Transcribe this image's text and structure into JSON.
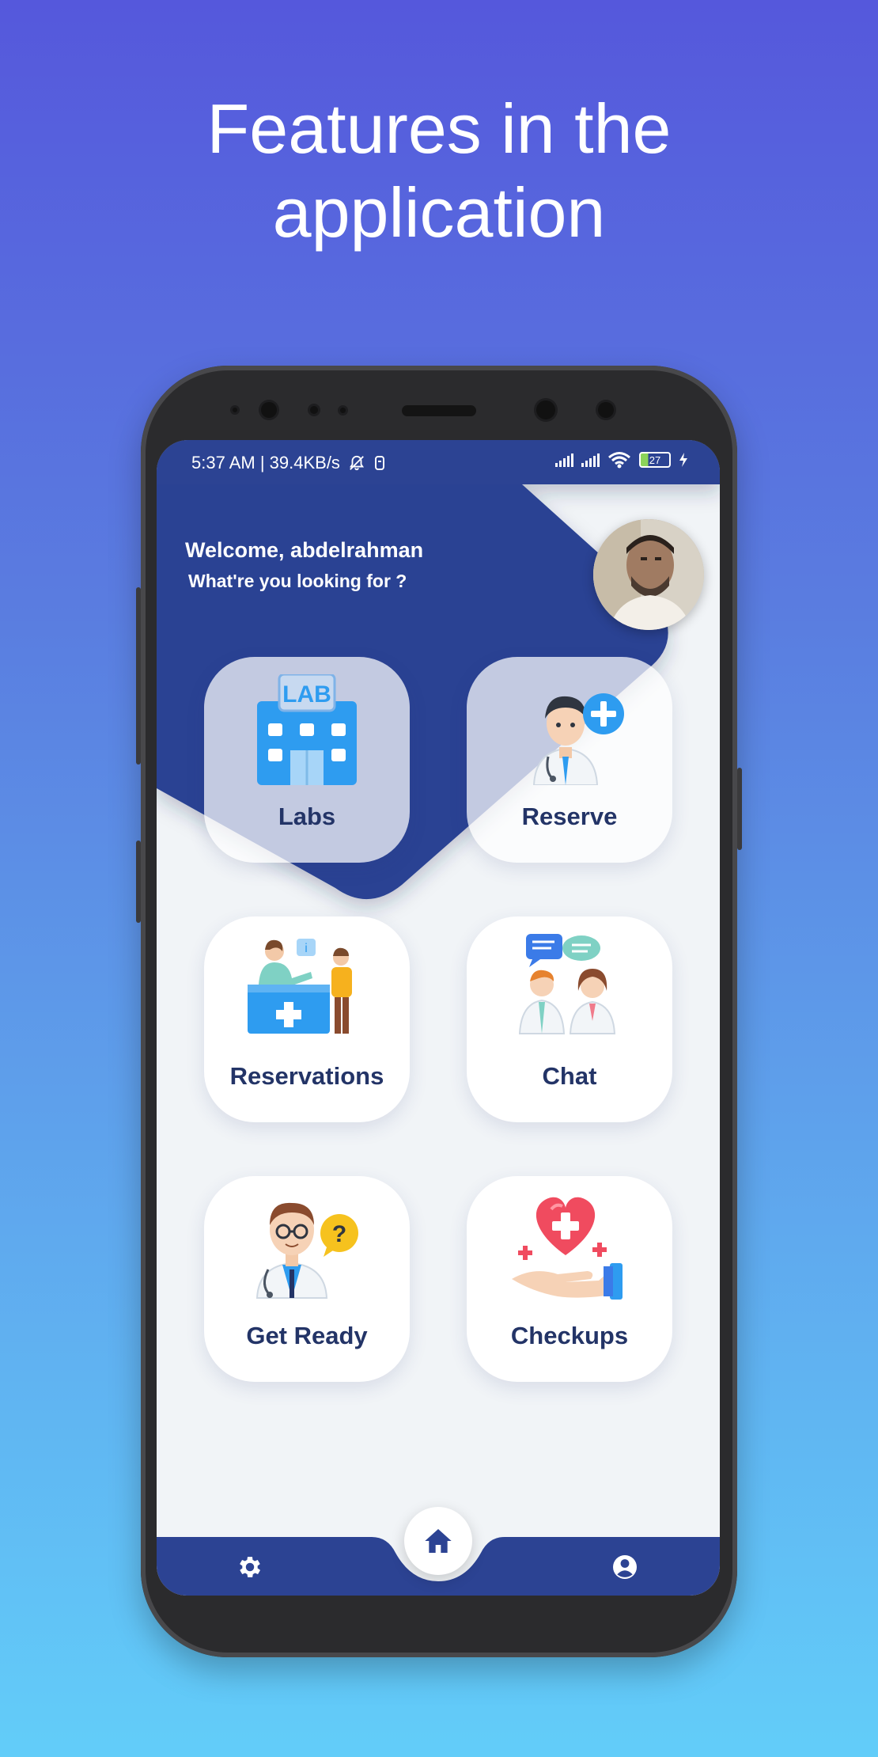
{
  "headline": {
    "line1": "Features in the",
    "line2": "application"
  },
  "status_bar": {
    "left_text": "5:37 AM | 39.4KB/s",
    "battery": "27",
    "icons": [
      "alarm-off-icon",
      "vibrate-icon",
      "signal-icon",
      "wifi-icon",
      "battery-icon",
      "charging-icon"
    ]
  },
  "header": {
    "welcome": "Welcome, abdelrahman",
    "subtitle": "What're you looking for ?"
  },
  "features": [
    {
      "label": "Labs",
      "icon": "lab-building-icon"
    },
    {
      "label": "Reserve",
      "icon": "doctor-plus-icon"
    },
    {
      "label": "Reservations",
      "icon": "reception-desk-icon"
    },
    {
      "label": "Chat",
      "icon": "doctors-chat-icon"
    },
    {
      "label": "Get Ready",
      "icon": "doctor-question-icon"
    },
    {
      "label": "Checkups",
      "icon": "heart-hand-icon"
    }
  ],
  "bottom_nav": {
    "items": [
      "settings-icon",
      "home-icon",
      "profile-icon"
    ]
  },
  "colors": {
    "primary_dark": "#2c4393",
    "label_text": "#233467",
    "background_top": "#5558dc",
    "background_bottom": "#62cdf9"
  }
}
